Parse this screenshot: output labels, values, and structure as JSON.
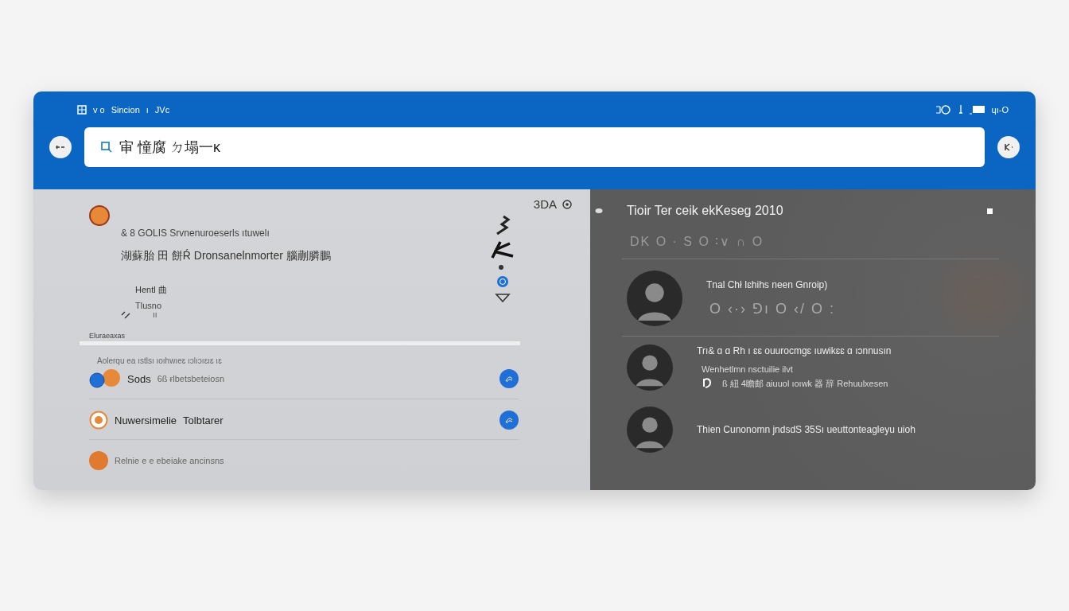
{
  "header": {
    "title_items": [
      "v o",
      "Sincion",
      "ı",
      "JVc"
    ],
    "status_text": "ɥı-O"
  },
  "search": {
    "value": "审 憧腐 ㄉ塌一κ"
  },
  "feed": {
    "counter": "3DA",
    "post": {
      "line_1": "& 8 GOLIS Srvnenuroeserls ıtuwelı",
      "line_2": "湖蘇胎 田 餅Ŕ Dronsanelnmorter 腦蒯膦鵬",
      "name": "Hentl 曲",
      "sub": "Tlusno",
      "mark": "ıı"
    },
    "section_label": "Eluraeaxas",
    "items": [
      {
        "kind": "double",
        "overline": "Aolerqu ea ıstlsı ıoıhwıeɛ ıɔlıɔıɛıɛ ıɛ",
        "title": "Sods",
        "text": "6ß ᵲlbetsbeteiosn",
        "color": "#e8893a"
      },
      {
        "kind": "single",
        "title": "Nuwersimelie",
        "text": "Tolbtarer",
        "color": "#e8893a"
      },
      {
        "kind": "plain",
        "text": "Relnie e e ebeiake ancinsns",
        "color": "#e07a2e"
      }
    ]
  },
  "chat": {
    "title": "Tioir Ter ceik ekKeseg 2010",
    "glyph_row": "DK  O · S  O ∶∨  ∩  O",
    "messages": [
      {
        "text": "Tnal Chł Iɛhihs neen Gnroip)",
        "sub": "O  ‹·›  ⅁ı  O  ‹/  O  :"
      },
      {
        "text": "Trı& ɑ ɑ Rh ı ɛɛ ouurocmgɛ ıuwikɛɛ ɑ ıɔnnusın",
        "sub": "Wenhetlmn nsctuilie ilvt",
        "extra": "ß 紐 4瞻邮 aiuuol ıoıwk 器 辞 Rehuulxesen"
      },
      {
        "text": "Thien Cunonomn jndsdS   35Sı ueuttonteagleyu uioh"
      }
    ]
  }
}
